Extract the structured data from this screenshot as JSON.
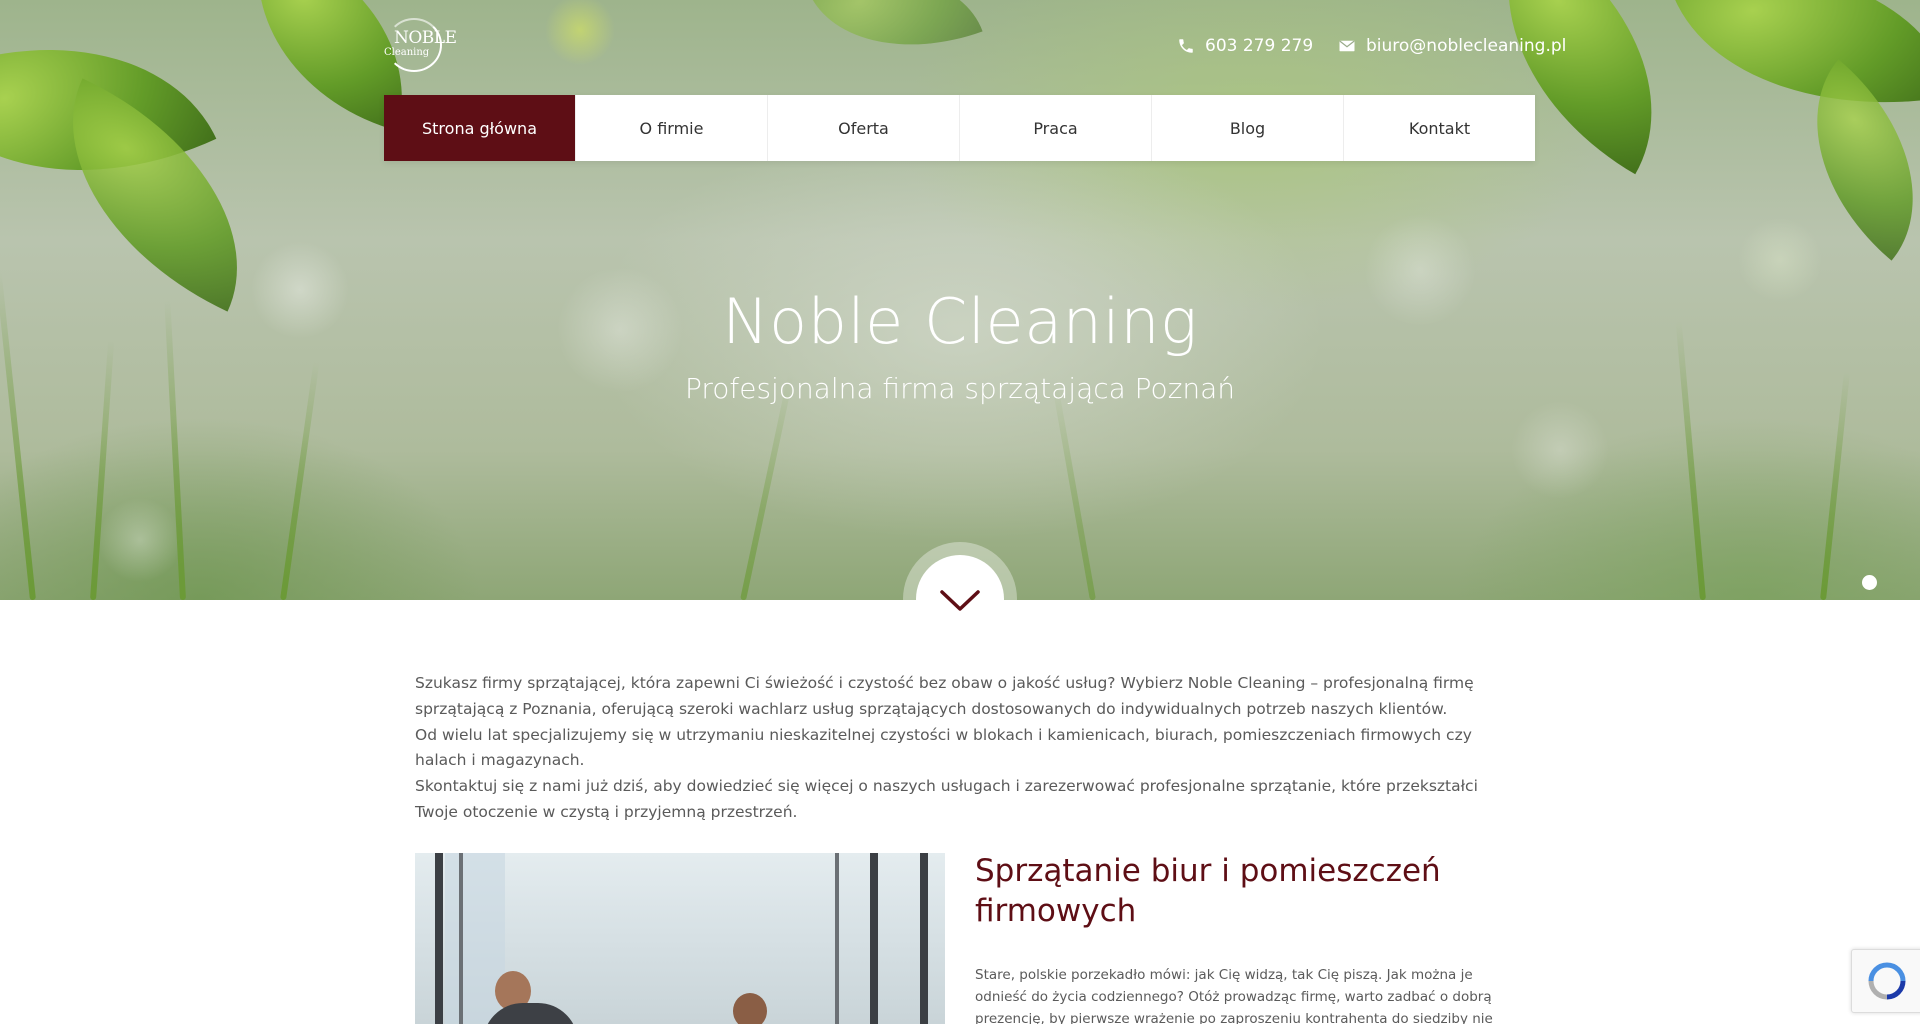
{
  "brand": {
    "logo_line1": "NOBLE",
    "logo_line2": "Cleaning"
  },
  "contact": {
    "phone": "603 279 279",
    "email": "biuro@noblecleaning.pl"
  },
  "nav": {
    "items": [
      {
        "label": "Strona główna",
        "active": true
      },
      {
        "label": "O firmie"
      },
      {
        "label": "Oferta"
      },
      {
        "label": "Praca"
      },
      {
        "label": "Blog"
      },
      {
        "label": "Kontakt"
      }
    ]
  },
  "hero": {
    "title": "Noble Cleaning",
    "subtitle": "Profesjonalna firma sprzątająca Poznań"
  },
  "intro": {
    "paragraphs": [
      "Szukasz firmy sprzątającej, która zapewni Ci świeżość i czystość bez obaw o jakość usług? Wybierz Noble Cleaning – profesjonalną firmę sprzątającą z Poznania, oferującą szeroki wachlarz usług sprzątających dostosowanych do indywidualnych potrzeb naszych klientów.",
      "Od wielu lat specjalizujemy się w utrzymaniu nieskazitelnej czystości w blokach i kamienicach, biurach, pomieszczeniach firmowych czy halach i magazynach.",
      "Skontaktuj się z nami już dziś, aby dowiedzieć się więcej o naszych usługach i zarezerwować profesjonalne sprzątanie, które przekształci Twoje otoczenie w czystą i przyjemną przestrzeń."
    ]
  },
  "section": {
    "title": "Sprzątanie biur i pomieszczeń firmowych",
    "text": "Stare, polskie porzekadło mówi: jak Cię widzą, tak Cię piszą. Jak można je odnieść do życia codziennego? Otóż prowadząc firmę, warto zadbać o dobrą prezencję, by pierwsze wrażenie po zaproszeniu kontrahenta do siedziby nie było mylne. Dlatego w"
  },
  "colors": {
    "brand": "#5e0e15",
    "text": "#5a5a5a",
    "nav_bg": "#ffffff"
  },
  "icons": {
    "phone": "phone-icon",
    "email": "envelope-icon",
    "scroll": "chevron-down-icon",
    "recaptcha": "recaptcha-icon"
  }
}
